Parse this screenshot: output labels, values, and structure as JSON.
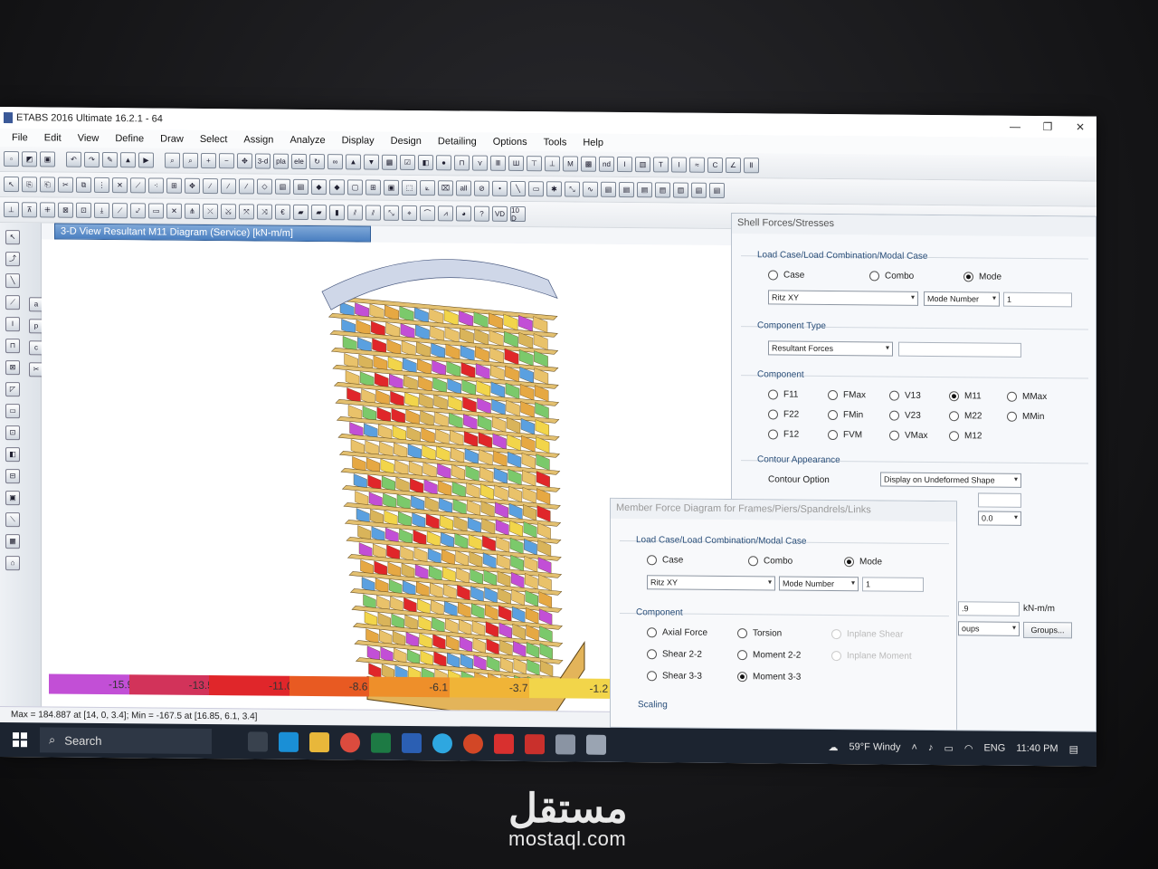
{
  "window": {
    "title": "ETABS 2016 Ultimate 16.2.1 - 64",
    "controls": [
      "—",
      "❐",
      "✕"
    ]
  },
  "menu": [
    "File",
    "Edit",
    "View",
    "Define",
    "Draw",
    "Select",
    "Assign",
    "Analyze",
    "Display",
    "Design",
    "Detailing",
    "Options",
    "Tools",
    "Help"
  ],
  "toolbar_labels": {
    "threed": "3-d",
    "pla": "pla",
    "ele": "ele",
    "nd": "nd",
    "all": "all",
    "vd": "VD",
    "ten": "10 D"
  },
  "view_tab": {
    "title": "3-D View   Resultant M11 Diagram   (Service)  [kN-m/m]"
  },
  "legend": {
    "labels": [
      "-15.9",
      "-13.5",
      "-11.0",
      "-8.6",
      "-6.1",
      "-3.7",
      "-1.2"
    ],
    "colors": [
      "#c24fd6",
      "#d2335a",
      "#e0262a",
      "#e85a22",
      "#ee8f2a",
      "#f0b437",
      "#f2d54a"
    ]
  },
  "status_text": "Max = 184.887 at [14, 0, 3.4];  Min = -167.5 at [16.85, 6.1, 3.4]",
  "shell_dialog": {
    "title": "Shell Forces/Stresses",
    "load_case_label": "Load Case/Load Combination/Modal Case",
    "radios": {
      "case": "Case",
      "combo": "Combo",
      "mode": "Mode"
    },
    "load_select": "Ritz XY",
    "mode_select": "Mode Number",
    "mode_value": "1",
    "component_type_label": "Component Type",
    "component_type_select": "Resultant Forces",
    "component_label": "Component",
    "components": [
      "F11",
      "FMax",
      "V13",
      "M11",
      "MMax",
      "F22",
      "FMin",
      "V23",
      "M22",
      "MMin",
      "F12",
      "FVM",
      "VMax",
      "M12"
    ],
    "selected_component": "M11",
    "contour_label": "Contour Appearance",
    "contour_option_label": "Contour Option",
    "contour_option_select": "Display on Undeformed Shape",
    "range_value": "0.0",
    "units_value": ".9",
    "units_label": "kN-m/m",
    "groups_select": "oups",
    "groups_button": "Groups..."
  },
  "member_dialog": {
    "title": "Member Force Diagram for Frames/Piers/Spandrels/Links",
    "load_case_label": "Load Case/Load Combination/Modal Case",
    "radios": {
      "case": "Case",
      "combo": "Combo",
      "mode": "Mode"
    },
    "load_select": "Ritz XY",
    "mode_select": "Mode Number",
    "mode_value": "1",
    "component_label": "Component",
    "components": {
      "axial": "Axial Force",
      "torsion": "Torsion",
      "inplane_shear": "Inplane Shear",
      "shear22": "Shear 2-2",
      "moment22": "Moment 2-2",
      "inplane_moment": "Inplane Moment",
      "shear33": "Shear 3-3",
      "moment33": "Moment 3-3"
    },
    "scaling_label": "Scaling"
  },
  "taskbar": {
    "search": "Search",
    "weather": "59°F  Windy",
    "lang": "ENG",
    "time": "11:40 PM"
  },
  "watermark": {
    "logo": "مستقل",
    "text": "mostaql.com"
  }
}
